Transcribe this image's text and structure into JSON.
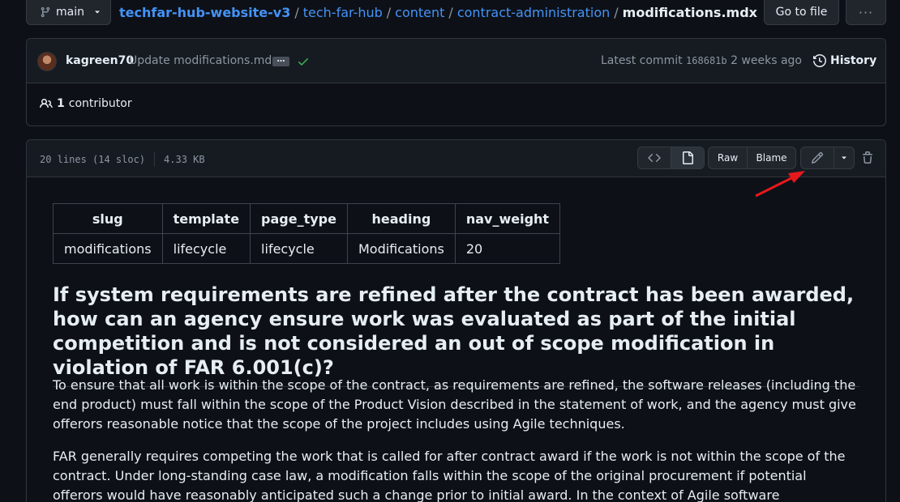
{
  "topbar": {
    "branch": "main",
    "breadcrumb": {
      "repo": "techfar-hub-website-v3",
      "segments": [
        "tech-far-hub",
        "content",
        "contract-administration"
      ],
      "file": "modifications.mdx",
      "separator": "/"
    },
    "goto_file": "Go to file",
    "more": "···"
  },
  "commit": {
    "author": "kagreen70",
    "message": "Update modifications.mdx",
    "ellipsis": "…",
    "latest_label": "Latest commit",
    "sha": "168681b",
    "time": "2 weeks ago",
    "history": "History"
  },
  "contributors": {
    "count": "1",
    "label": "contributor"
  },
  "file": {
    "lines": "20 lines (14 sloc)",
    "size": "4.33 KB",
    "raw": "Raw",
    "blame": "Blame"
  },
  "meta_table": {
    "headers": [
      "slug",
      "template",
      "page_type",
      "heading",
      "nav_weight"
    ],
    "row": [
      "modifications",
      "lifecycle",
      "lifecycle",
      "Modifications",
      "20"
    ]
  },
  "doc": {
    "heading": "If system requirements are refined after the contract has been awarded, how can an agency ensure work was evaluated as part of the initial competition and is not considered an out of scope modification in violation of FAR 6.001(c)?",
    "p1": "To ensure that all work is within the scope of the contract, as requirements are refined, the software releases (including the end product) must fall within the scope of the Product Vision described in the statement of work, and the agency must give offerors reasonable notice that the scope of the project includes using Agile techniques.",
    "p2": "FAR generally requires competing the work that is called for after contract award if the work is not within the scope of the contract. Under long-standing case law, a modification falls within the scope of the original procurement if potential offerors would have reasonably anticipated such a change prior to initial award. In the context of Agile software development, this ultimately means that"
  },
  "colors": {
    "background": "#0d1117",
    "link": "#4493f8",
    "success": "#3fb950",
    "annotation_arrow": "#e5191b"
  }
}
